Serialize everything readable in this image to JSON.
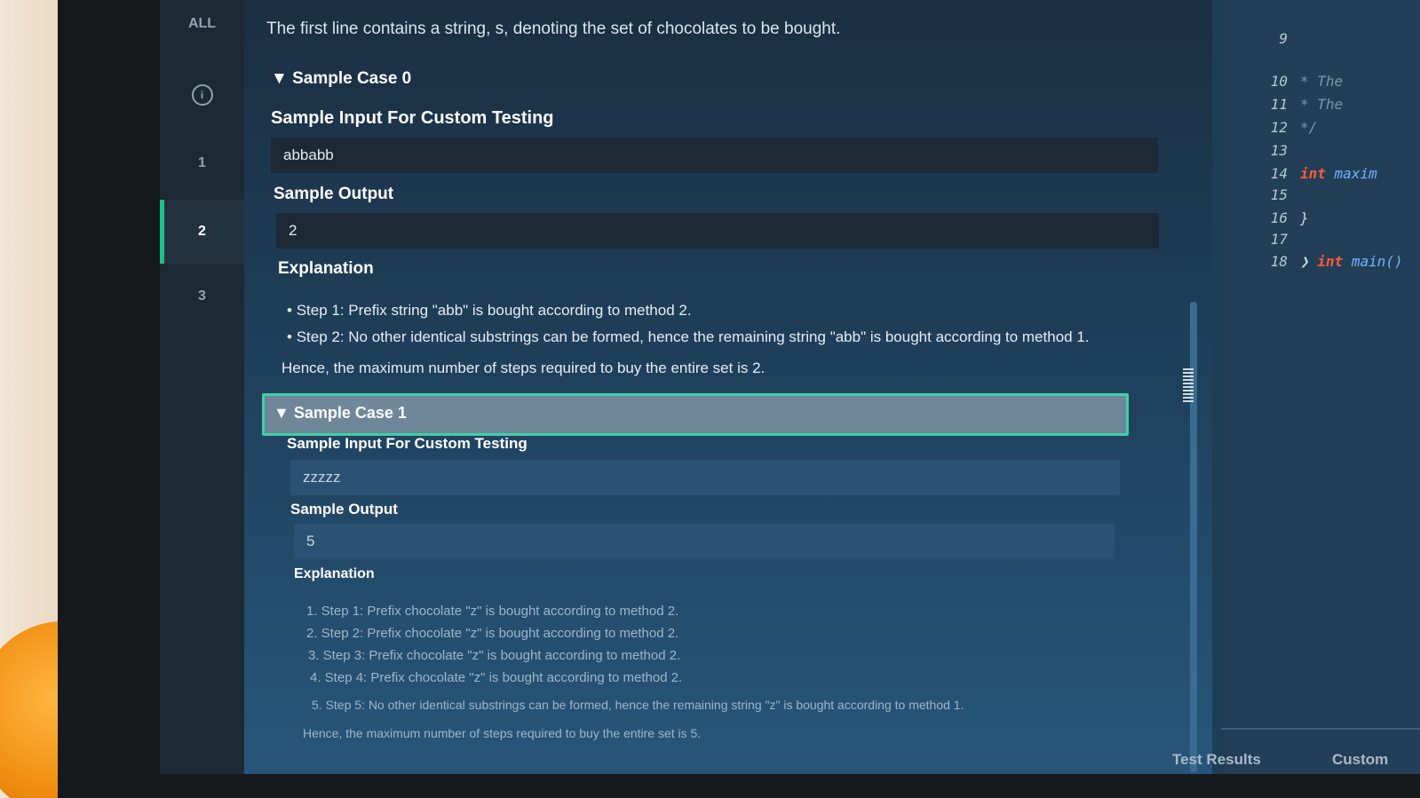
{
  "nav": {
    "all_label": "ALL",
    "items": [
      "1",
      "2",
      "3"
    ],
    "active_item": "2"
  },
  "problem": {
    "input_description": "The first line contains a string, s, denoting the set of chocolates to be bought.",
    "cases": [
      {
        "title": "Sample Case 0",
        "input_heading": "Sample Input For Custom Testing",
        "input": "abbabb",
        "output_heading": "Sample Output",
        "output": "2",
        "explanation_heading": "Explanation",
        "steps": [
          "Step 1: Prefix string \"abb\" is bought according to method 2.",
          "Step 2: No other identical substrings can be formed, hence the remaining string \"abb\" is bought according to method 1."
        ],
        "conclusion": "Hence, the maximum number of steps required to buy the entire set is 2."
      },
      {
        "title": "Sample Case 1",
        "input_heading": "Sample Input For Custom Testing",
        "input": "zzzzz",
        "output_heading": "Sample Output",
        "output": "5",
        "explanation_heading": "Explanation",
        "steps": [
          "1. Step 1: Prefix chocolate \"z\" is bought according to method 2.",
          "2. Step 2: Prefix chocolate \"z\" is bought according to method 2.",
          "3. Step 3: Prefix chocolate \"z\" is bought according to method 2.",
          "4. Step 4: Prefix chocolate \"z\" is bought according to method 2.",
          "5. Step 5: No other identical substrings can be formed, hence the remaining string \"z\" is bought according to method 1."
        ],
        "conclusion": "Hence, the maximum number of steps required to buy the entire set is 5."
      }
    ]
  },
  "editor": {
    "lines": [
      {
        "num": "9",
        "code": ""
      },
      {
        "num": "10",
        "code": "* The"
      },
      {
        "num": "11",
        "code": "* The"
      },
      {
        "num": "12",
        "code": "*/"
      },
      {
        "num": "13",
        "code": ""
      },
      {
        "num": "14",
        "kw": "int",
        "fn": "maxim"
      },
      {
        "num": "15",
        "code": ""
      },
      {
        "num": "16",
        "code": "}"
      },
      {
        "num": "17",
        "code": ""
      },
      {
        "num": "18",
        "kw": "int",
        "fn": "main()"
      }
    ]
  },
  "bottom_tabs": {
    "test_results": "Test Results",
    "custom": "Custom"
  },
  "colors": {
    "accent": "#3fd1a8",
    "keyword": "#ff5a36",
    "function": "#6fb4ff",
    "panel": "#1f3d56"
  }
}
